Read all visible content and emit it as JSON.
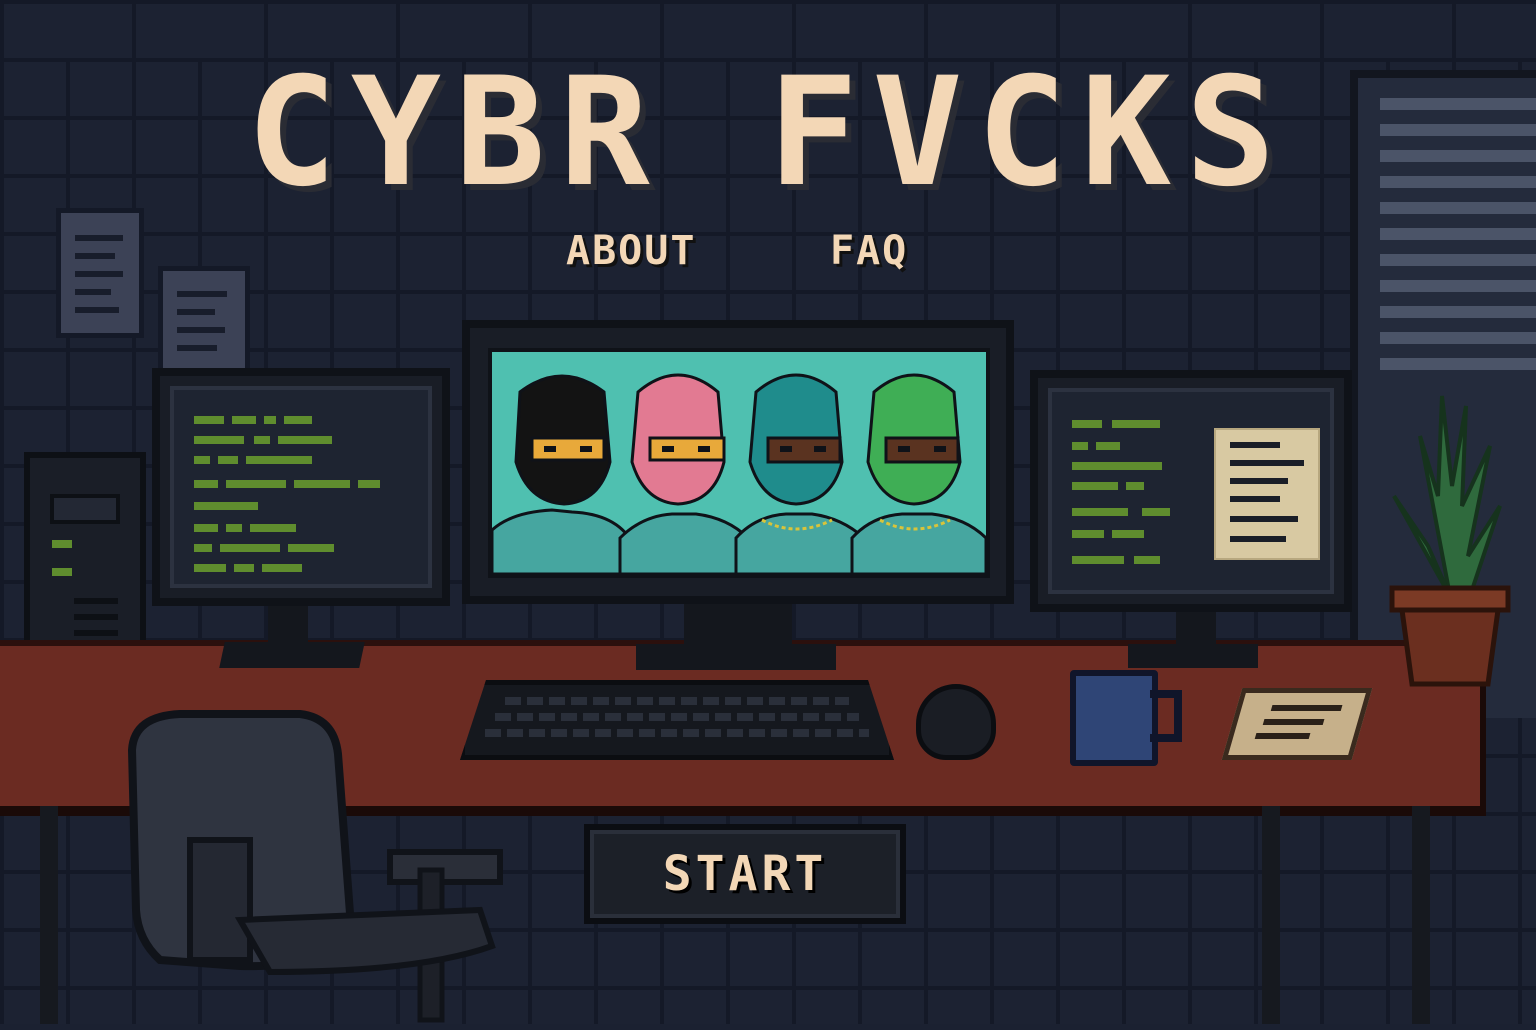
{
  "game": {
    "title": "CYBR FVCKS",
    "menu": {
      "about_label": "ABOUT",
      "faq_label": "FAQ",
      "start_label": "START"
    }
  },
  "colors": {
    "title": "#f3d7b6",
    "wall": "#1c2232",
    "desk": "#6b2b22",
    "screen": "#4fc0b0",
    "code_green": "#5f8d2e"
  },
  "characters": [
    {
      "mask_color": "#131313",
      "eye_band": "#e8a93a"
    },
    {
      "mask_color": "#e27a92",
      "eye_band": "#e8a93a"
    },
    {
      "mask_color": "#1f8c8c",
      "eye_band": "#5a3320"
    },
    {
      "mask_color": "#3fae55",
      "eye_band": "#5a3320"
    }
  ]
}
